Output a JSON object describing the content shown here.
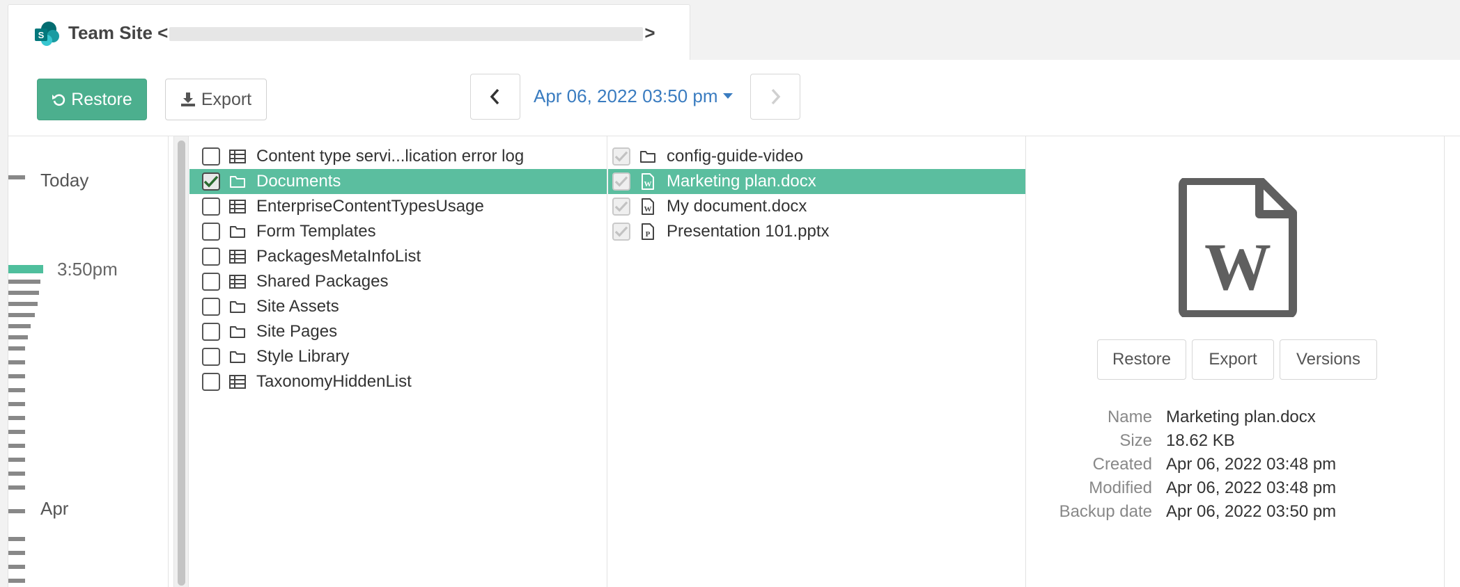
{
  "tab": {
    "title_prefix": "Team Site <",
    "title_suffix": ">"
  },
  "toolbar": {
    "restore_label": "Restore",
    "export_label": "Export",
    "date_label": "Apr 06, 2022 03:50 pm"
  },
  "timeline": {
    "today_label": "Today",
    "current_time": "3:50pm",
    "month_label": "Apr"
  },
  "left_list": [
    {
      "label": "Content type servi...lication error log",
      "icon": "list-icon",
      "checked": false
    },
    {
      "label": "Documents",
      "icon": "folder-icon",
      "checked": true
    },
    {
      "label": "EnterpriseContentTypesUsage",
      "icon": "list-icon",
      "checked": false
    },
    {
      "label": "Form Templates",
      "icon": "folder-icon",
      "checked": false
    },
    {
      "label": "PackagesMetaInfoList",
      "icon": "list-icon",
      "checked": false
    },
    {
      "label": "Shared Packages",
      "icon": "list-icon",
      "checked": false
    },
    {
      "label": "Site Assets",
      "icon": "folder-icon",
      "checked": false
    },
    {
      "label": "Site Pages",
      "icon": "folder-icon",
      "checked": false
    },
    {
      "label": "Style Library",
      "icon": "folder-icon",
      "checked": false
    },
    {
      "label": "TaxonomyHiddenList",
      "icon": "list-icon",
      "checked": false
    }
  ],
  "middle_list": [
    {
      "label": "config-guide-video",
      "icon": "folder-icon"
    },
    {
      "label": "Marketing plan.docx",
      "icon": "word-file-icon"
    },
    {
      "label": "My document.docx",
      "icon": "word-file-icon"
    },
    {
      "label": "Presentation 101.pptx",
      "icon": "powerpoint-file-icon"
    }
  ],
  "preview": {
    "icon": "word-document-icon",
    "restore_label": "Restore",
    "export_label": "Export",
    "versions_label": "Versions",
    "meta": [
      {
        "key": "Name",
        "value": "Marketing plan.docx"
      },
      {
        "key": "Size",
        "value": "18.62 KB"
      },
      {
        "key": "Created",
        "value": "Apr 06, 2022 03:48 pm"
      },
      {
        "key": "Modified",
        "value": "Apr 06, 2022 03:48 pm"
      },
      {
        "key": "Backup date",
        "value": "Apr 06, 2022 03:50 pm"
      }
    ]
  },
  "colors": {
    "accent": "#4caf8e",
    "selection": "#5bbe9f",
    "link": "#3a7cc0"
  }
}
